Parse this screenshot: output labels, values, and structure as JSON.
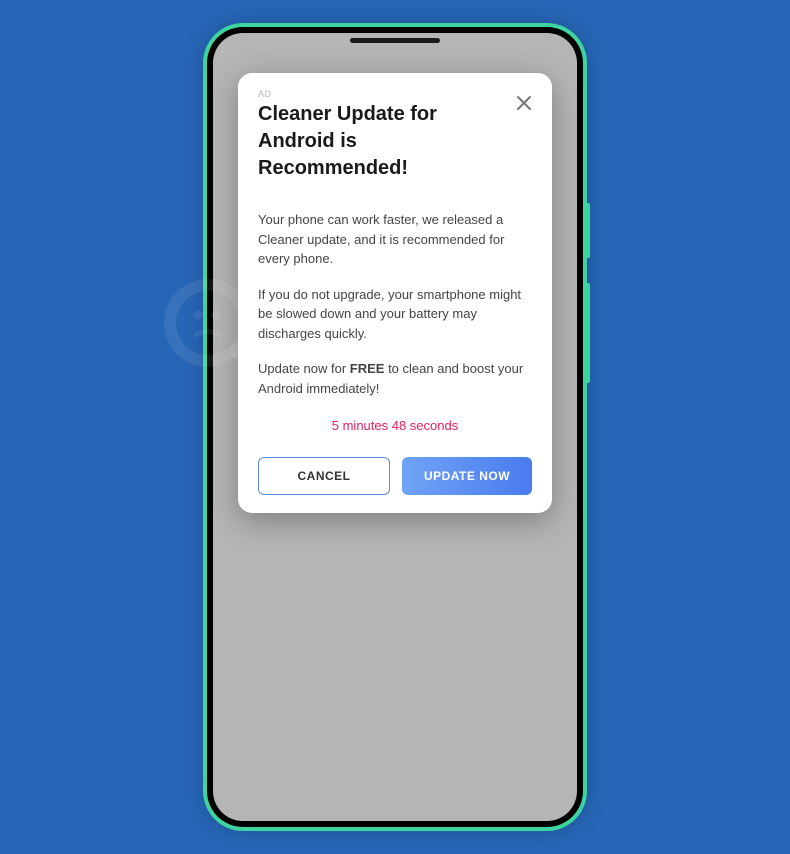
{
  "modal": {
    "ad_label": "AD",
    "title": "Cleaner Update for Android is Recommended!",
    "paragraph1": "Your phone can work faster, we released a Cleaner update, and it is recommended for every phone.",
    "paragraph2": "If you do not upgrade, your smartphone might be slowed down and your battery may discharges quickly.",
    "paragraph3_pre": "Update now for ",
    "paragraph3_bold": "FREE",
    "paragraph3_post": " to clean and boost your Android immediately!",
    "countdown": "5 minutes 48 seconds",
    "cancel_label": "CANCEL",
    "update_label": "UPDATE NOW"
  }
}
